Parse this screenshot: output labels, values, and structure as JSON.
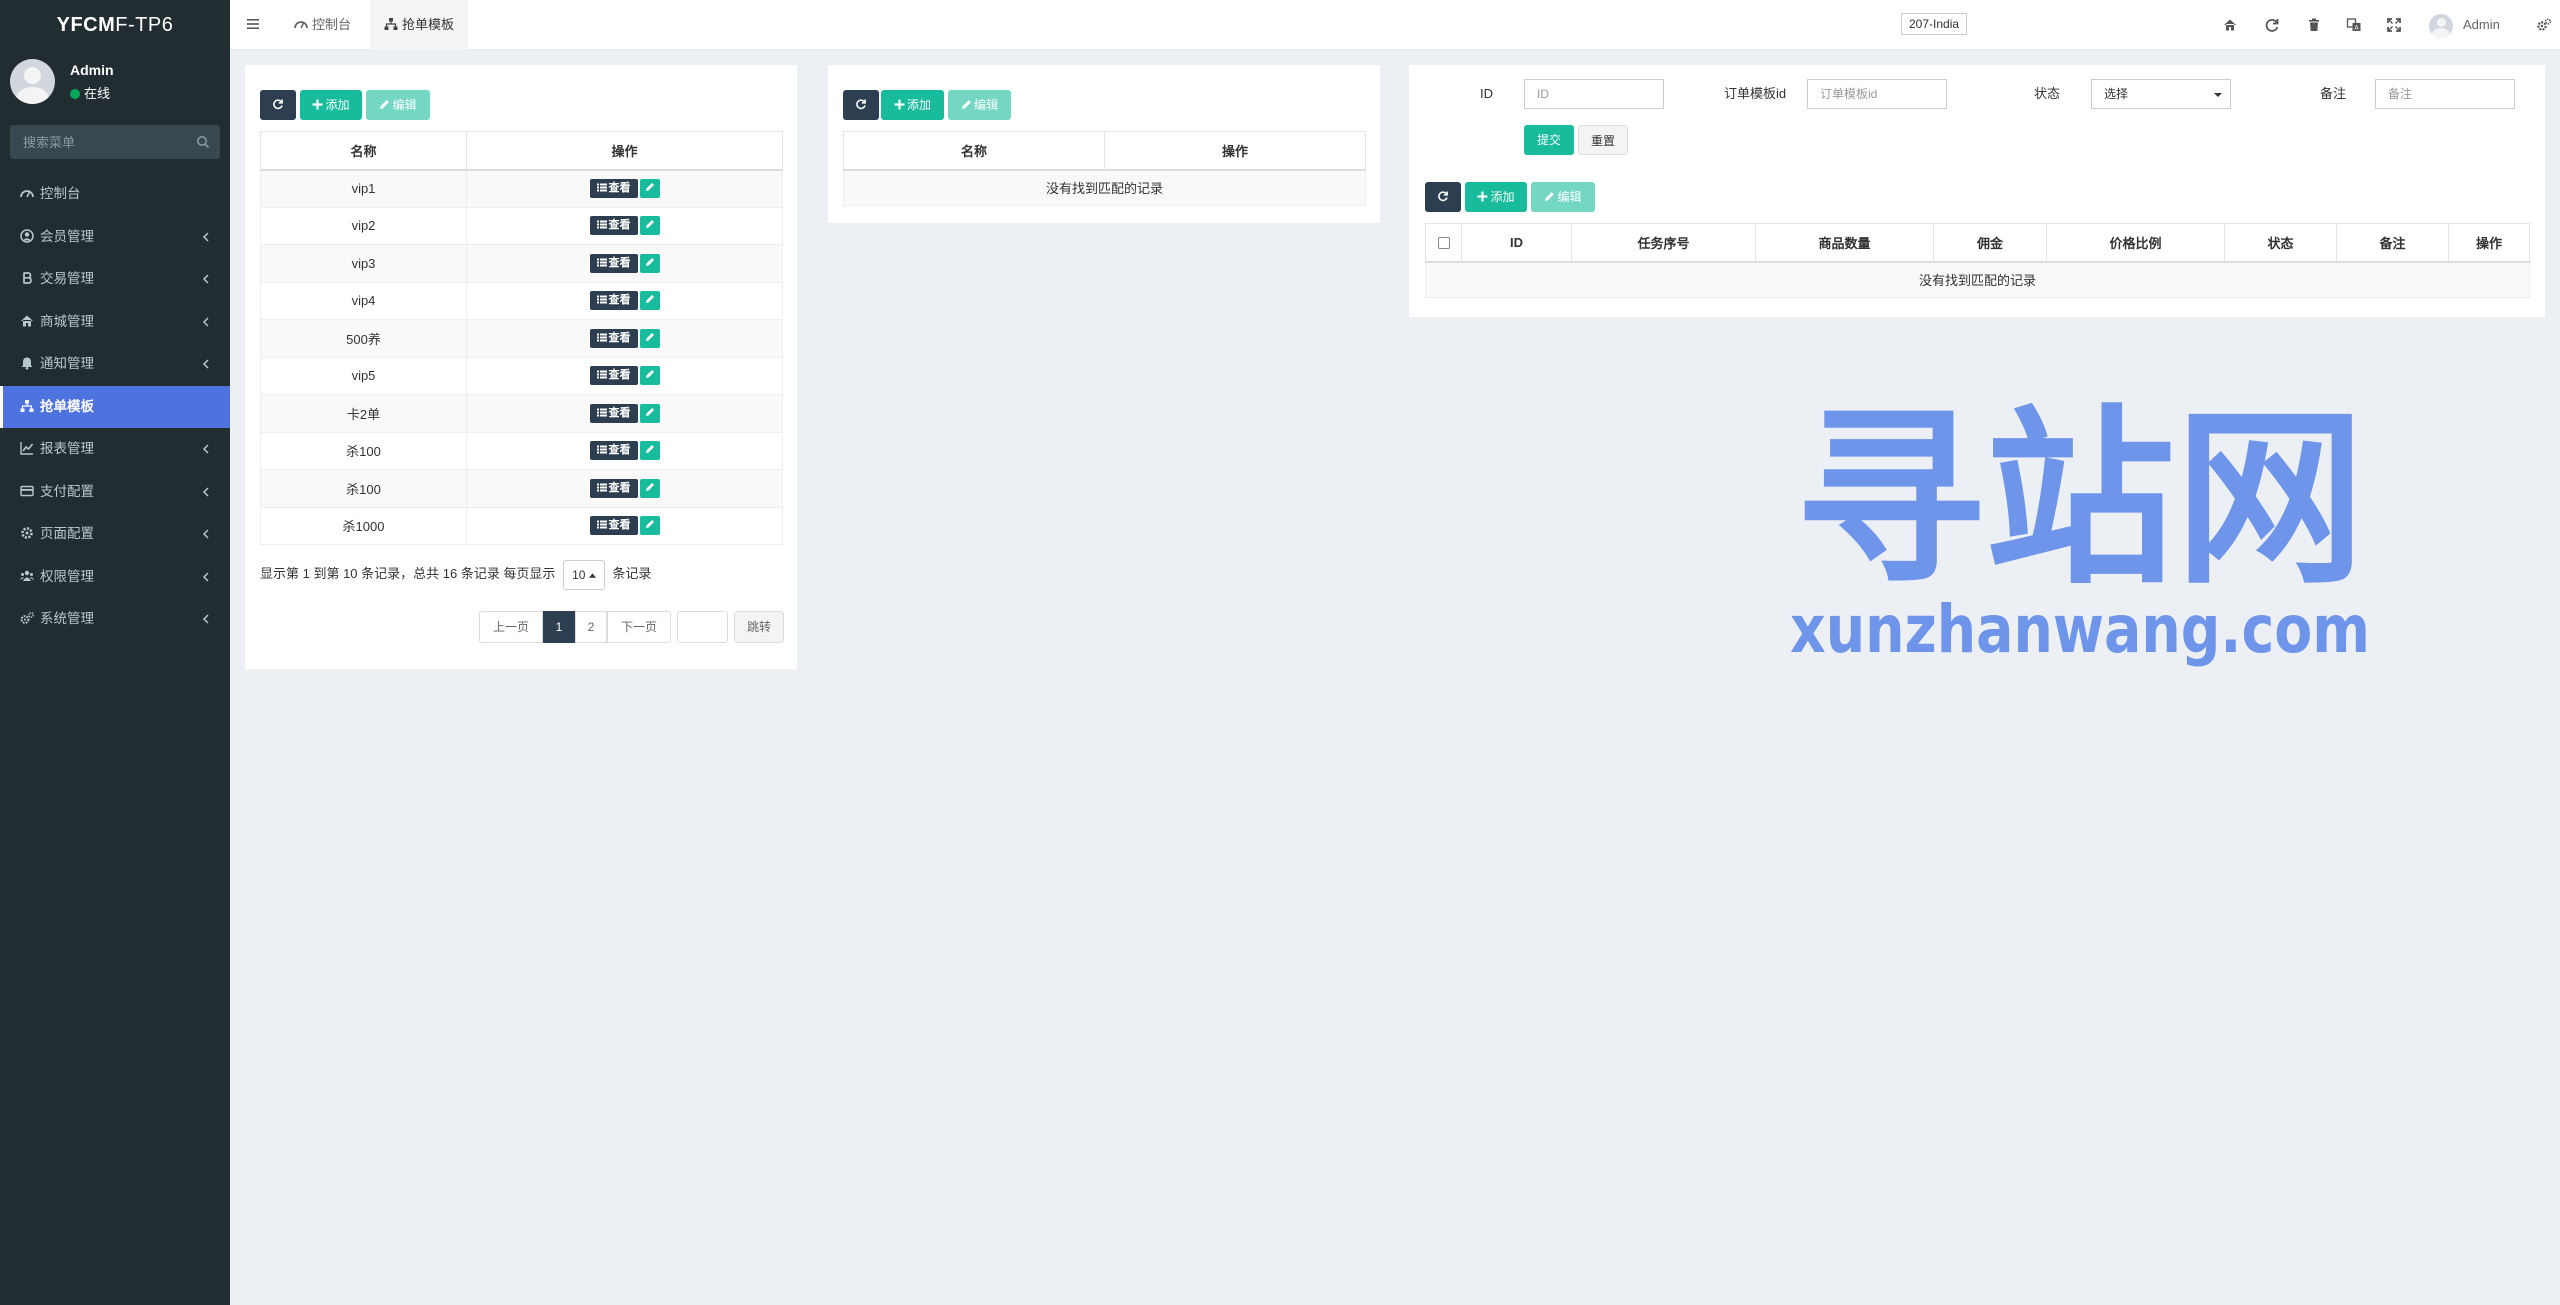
{
  "sidebar": {
    "logo_bold": "YFCM",
    "logo_light": "F-TP6",
    "user_name": "Admin",
    "user_status": "在线",
    "search_placeholder": "搜索菜单",
    "items": [
      {
        "label": "控制台",
        "icon": "dashboard-icon",
        "has_children": false
      },
      {
        "label": "会员管理",
        "icon": "user-circle-icon",
        "has_children": true
      },
      {
        "label": "交易管理",
        "icon": "bitcoin-icon",
        "has_children": true
      },
      {
        "label": "商城管理",
        "icon": "home-icon",
        "has_children": true
      },
      {
        "label": "通知管理",
        "icon": "bell-icon",
        "has_children": true
      },
      {
        "label": "抢单模板",
        "icon": "sitemap-icon",
        "has_children": false,
        "active": true
      },
      {
        "label": "报表管理",
        "icon": "line-chart-icon",
        "has_children": true
      },
      {
        "label": "支付配置",
        "icon": "credit-card-icon",
        "has_children": true
      },
      {
        "label": "页面配置",
        "icon": "gear-icon",
        "has_children": true
      },
      {
        "label": "权限管理",
        "icon": "users-icon",
        "has_children": true
      },
      {
        "label": "系统管理",
        "icon": "gears-icon",
        "has_children": true
      }
    ]
  },
  "header": {
    "tabs": [
      {
        "label": "控制台",
        "icon": "dashboard-icon"
      },
      {
        "label": "抢单模板",
        "icon": "sitemap-icon"
      }
    ],
    "region": "207-India",
    "admin_name": "Admin",
    "icons": [
      "home-icon",
      "refresh-icon",
      "trash-icon",
      "translate-icon",
      "expand-icon",
      "gears-icon"
    ]
  },
  "left_panel": {
    "toolbar": {
      "add": "添加",
      "edit": "编辑"
    },
    "columns": [
      "名称",
      "操作"
    ],
    "rows": [
      "vip1",
      "vip2",
      "vip3",
      "vip4",
      "500养",
      "vip5",
      "卡2单",
      "杀100",
      "杀100",
      "杀1000"
    ],
    "view_label": "查看",
    "pagination_info": "显示第 1 到第 10 条记录，总共 16 条记录 每页显示",
    "page_size": "10",
    "records_suffix": "条记录",
    "prev": "上一页",
    "pages": [
      "1",
      "2"
    ],
    "current_page": "1",
    "next": "下一页",
    "jump": "跳转"
  },
  "middle_panel": {
    "toolbar": {
      "add": "添加",
      "edit": "编辑"
    },
    "columns": [
      "名称",
      "操作"
    ],
    "empty": "没有找到匹配的记录"
  },
  "right_panel": {
    "filters": {
      "id_label": "ID",
      "id_placeholder": "ID",
      "template_label": "订单模板id",
      "template_placeholder": "订单模板id",
      "status_label": "状态",
      "status_value": "选择",
      "remark_label": "备注",
      "remark_placeholder": "备注",
      "submit": "提交",
      "reset": "重置"
    },
    "toolbar": {
      "add": "添加",
      "edit": "编辑"
    },
    "columns": [
      "ID",
      "任务序号",
      "商品数量",
      "佣金",
      "价格比例",
      "状态",
      "备注",
      "操作"
    ],
    "empty": "没有找到匹配的记录"
  },
  "watermark": {
    "cn": "寻站网",
    "url": "xunzhanwang.com",
    "color": "#6f95eb"
  }
}
